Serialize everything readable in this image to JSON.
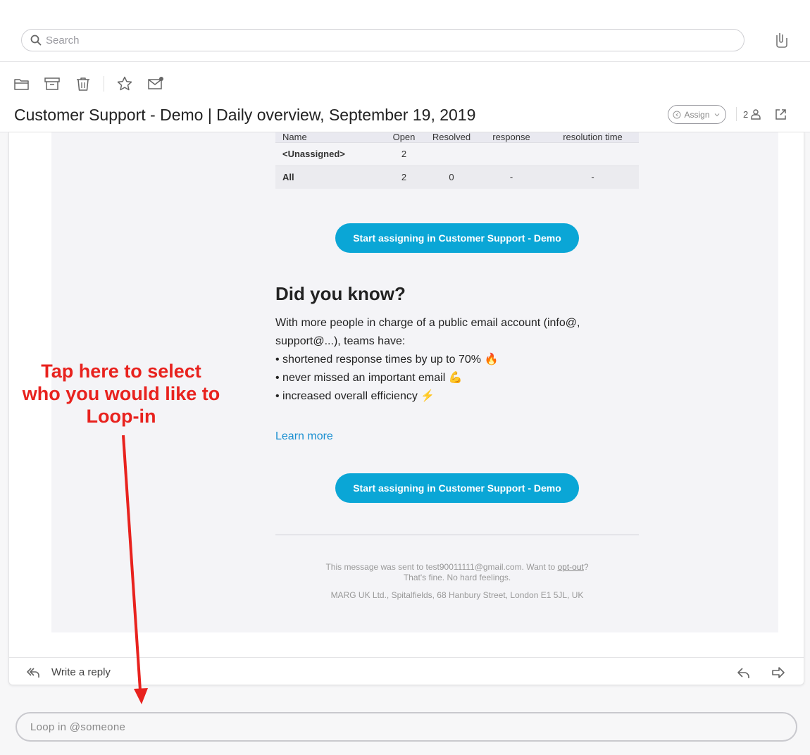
{
  "search": {
    "placeholder": "Search"
  },
  "toolbar": {
    "icons": [
      "folder-icon",
      "archive-icon",
      "trash-icon",
      "star-icon",
      "mark-unread-icon"
    ]
  },
  "conversation": {
    "title": "Customer Support - Demo | Daily overview, September 19, 2019",
    "assign_label": "Assign",
    "participants_count": "2"
  },
  "email": {
    "table": {
      "headers": [
        "Name",
        "Open",
        "Resolved",
        "response",
        "resolution time"
      ],
      "rows": [
        [
          "<Unassigned>",
          "2",
          "",
          "",
          ""
        ],
        [
          "All",
          "2",
          "0",
          "-",
          "-"
        ]
      ]
    },
    "cta_label": "Start assigning in Customer Support - Demo",
    "did_you_know": "Did you know?",
    "para_lines": [
      "With more people in charge of a public email account (info@,",
      "support@...), teams have:",
      "• shortened response times by up to 70% 🔥",
      "• never missed an important email 💪",
      "• increased overall efficiency ⚡"
    ],
    "learn_more": "Learn more",
    "footer": {
      "sent_prefix": "This message was sent to test90011111@gmail.com. Want to ",
      "opt_out": "opt-out",
      "sent_suffix": "?",
      "line2": "That's fine. No hard feelings.",
      "address": "MARG UK Ltd., Spitalfields, 68 Hanbury Street, London E1 5JL, UK"
    }
  },
  "reply": {
    "placeholder": "Write a reply"
  },
  "loop": {
    "placeholder": "Loop in @someone"
  },
  "annotation": {
    "text": "Tap here to select who you would like to Loop-in",
    "color": "#e8221e"
  }
}
